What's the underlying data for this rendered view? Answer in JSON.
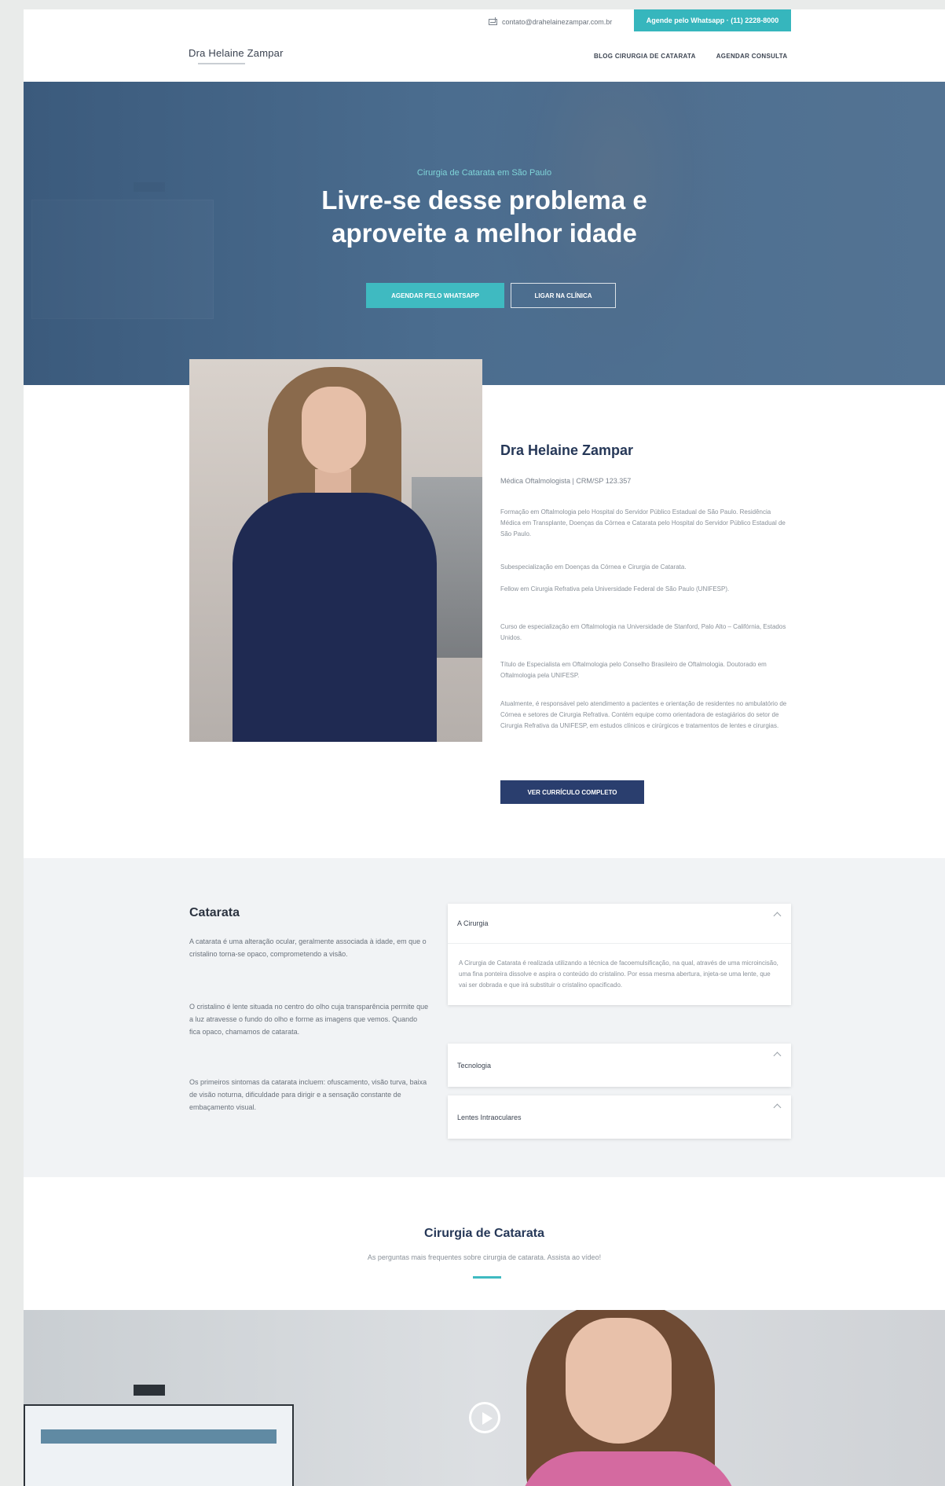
{
  "header": {
    "email": "contato@drahelainezampar.com.br",
    "whatsapp_label": "Agende pelo Whatsapp · (11) 2228-8000",
    "logo": "Dra Helaine Zampar",
    "nav": [
      "BLOG CIRURGIA DE CATARATA",
      "AGENDAR CONSULTA"
    ]
  },
  "hero": {
    "kicker": "Cirurgia de Catarata em São Paulo",
    "title_line1": "Livre-se desse problema e",
    "title_line2": "aproveite a melhor idade",
    "primary_button": "AGENDAR PELO WHATSAPP",
    "secondary_button": "LIGAR NA CLÍNICA"
  },
  "about": {
    "name": "Dra Helaine Zampar",
    "role": "Médica Oftalmologista | CRM/SP 123.357",
    "paragraphs": [
      "Formação em Oftalmologia pelo Hospital do Servidor Público Estadual de São Paulo. Residência Médica em Transplante, Doenças da Córnea e Catarata pelo Hospital do Servidor Público Estadual de São Paulo.",
      "Subespecialização em Doenças da Córnea e Cirurgia de Catarata.",
      "Fellow em Cirurgia Refrativa pela Universidade Federal de São Paulo (UNIFESP).",
      "Curso de especialização em Oftalmologia na Universidade de Stanford, Palo Alto – Califórnia, Estados Unidos.",
      "Título de Especialista em Oftalmologia pelo Conselho Brasileiro de Oftalmologia. Doutorado em Oftalmologia pela UNIFESP.",
      "Atualmente, é responsável pelo atendimento a pacientes e orientação de residentes no ambulatório de Córnea e setores de Cirurgia Refrativa. Contém equipe como orientadora de estagiários do setor de Cirurgia Refrativa da UNIFESP, em estudos clínicos e cirúrgicos e tratamentos de lentes e cirurgias."
    ],
    "button": "VER CURRÍCULO COMPLETO"
  },
  "catarata": {
    "title": "Catarata",
    "paragraphs": [
      "A catarata é uma alteração ocular, geralmente associada à idade, em que o cristalino torna-se opaco, comprometendo a visão.",
      "O cristalino é lente situada no centro do olho cuja transparência permite que a luz atravesse o fundo do olho e forme as imagens que vemos. Quando fica opaco, chamamos de catarata.",
      "Os primeiros sintomas da catarata incluem: ofuscamento, visão turva, baixa de visão noturna, dificuldade para dirigir e a sensação constante de embaçamento visual."
    ],
    "accordion": [
      {
        "title": "A Cirurgia",
        "open": true,
        "body": "A Cirurgia de Catarata é realizada utilizando a técnica de facoemulsificação, na qual, através de uma microincisão, uma fina ponteira dissolve e aspira o conteúdo do cristalino. Por essa mesma abertura, injeta-se uma lente, que vai ser dobrada e que irá substituir o cristalino opacificado."
      },
      {
        "title": "Tecnologia",
        "open": false,
        "body": ""
      },
      {
        "title": "Lentes Intraoculares",
        "open": false,
        "body": ""
      }
    ]
  },
  "video_intro": {
    "title": "Cirurgia de Catarata",
    "subtitle": "As perguntas mais frequentes sobre cirurgia de catarata. Assista ao vídeo!"
  },
  "colors": {
    "teal": "#3fbac1",
    "navy": "#2a3e6e",
    "hero_blue": "#4d6f91"
  },
  "icons": [
    "mail-icon",
    "chevron-up-icon",
    "play-icon"
  ]
}
